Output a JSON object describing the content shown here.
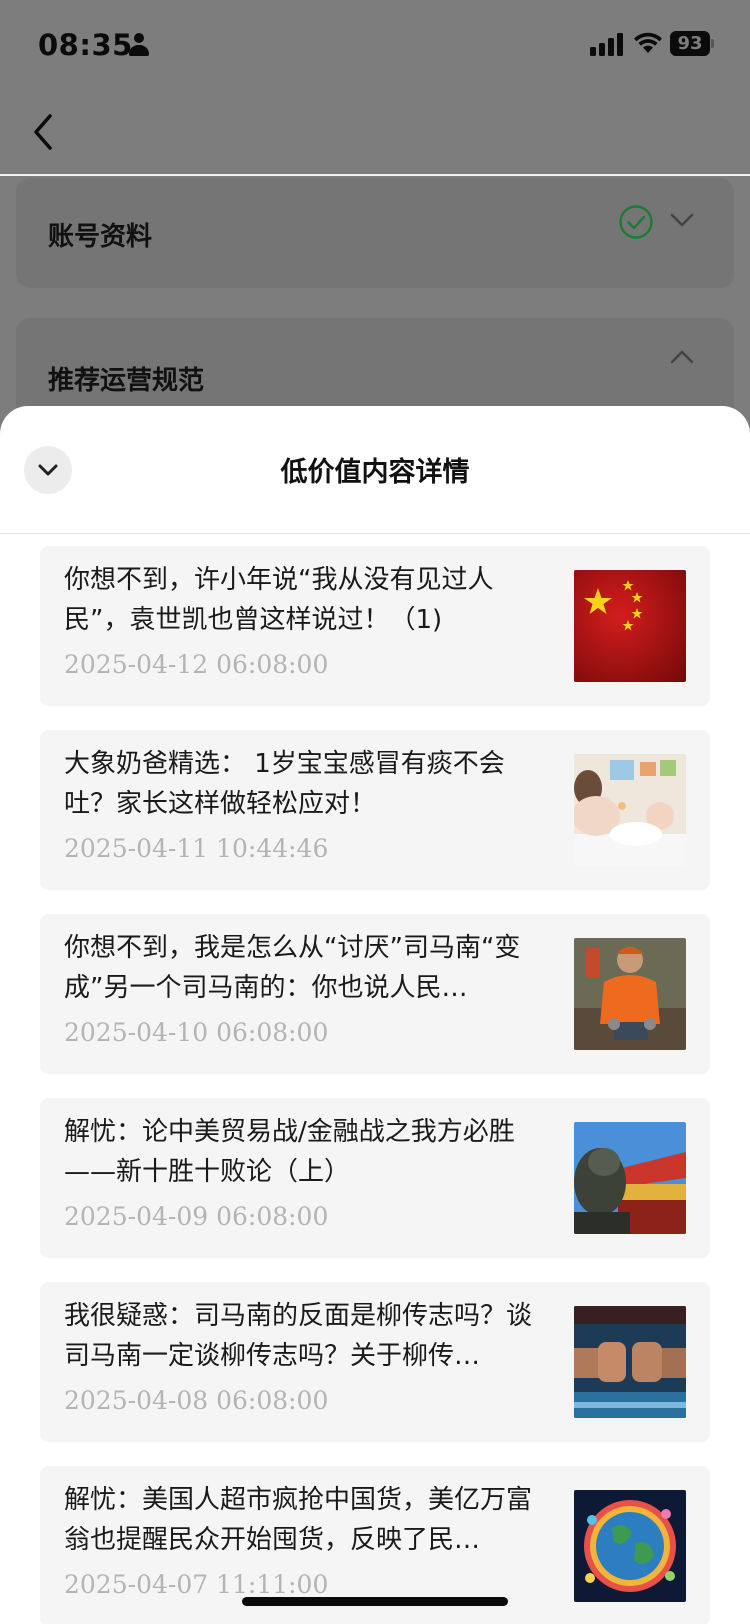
{
  "status_bar": {
    "time": "08:35",
    "battery": "93"
  },
  "background": {
    "cards": [
      {
        "title": "账号资料",
        "status_icon": "check-circle-icon",
        "chevron": "chevron-down-icon",
        "accent": "#1f8a3a"
      },
      {
        "title": "推荐运营规范",
        "chevron": "chevron-up-icon"
      }
    ]
  },
  "sheet": {
    "title": "低价值内容详情",
    "items": [
      {
        "title": "你想不到，许小年说“我从没有见过人民”，袁世凯也曾这样说过！（1)",
        "date": "2025-04-12 06:08:00",
        "thumb": "china-flag"
      },
      {
        "title": "大象奶爸精选： 1岁宝宝感冒有痰不会吐？家长这样做轻松应对！",
        "date": "2025-04-11 10:44:46",
        "thumb": "parent-baby-photo"
      },
      {
        "title": "你想不到，我是怎么从“讨厌”司马南“变成”另一个司马南的：你也说人民…",
        "date": "2025-04-10 06:08:00",
        "thumb": "worker-orange-jacket-photo"
      },
      {
        "title": "解忧：论中美贸易战/金融战之我方必胜——新十胜十败论（上）",
        "date": "2025-04-09 06:08:00",
        "thumb": "stone-lion-palace-photo"
      },
      {
        "title": "我很疑惑：司马南的反面是柳传志吗？谈司马南一定谈柳传志吗？关于柳传…",
        "date": "2025-04-08 06:08:00",
        "thumb": "fists-bump-photo"
      },
      {
        "title": "解忧：美国人超市疯抢中国货，美亿万富翁也提醒民众开始囤货，反映了民…",
        "date": "2025-04-07 11:11:00",
        "thumb": "globe-products-photo"
      }
    ]
  }
}
